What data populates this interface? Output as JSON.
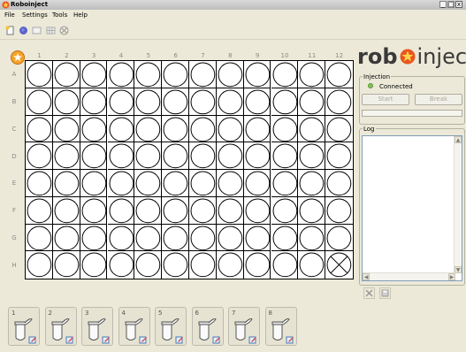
{
  "window": {
    "title": "Roboinject",
    "minimize": "_",
    "maximize": "□",
    "close": "x"
  },
  "menu": {
    "items": [
      "File",
      "Settings",
      "Tools",
      "Help"
    ]
  },
  "toolbar": {
    "icons": [
      "new-file-icon",
      "globe-icon",
      "window-icon",
      "grid-icon",
      "cancel-icon"
    ]
  },
  "plate": {
    "columns": [
      "1",
      "2",
      "3",
      "4",
      "5",
      "6",
      "7",
      "8",
      "9",
      "10",
      "11",
      "12"
    ],
    "rows": [
      "A",
      "B",
      "C",
      "D",
      "E",
      "F",
      "G",
      "H"
    ],
    "marked_well": "H12"
  },
  "logo": {
    "bold": "rob",
    "rest": "inject"
  },
  "injection": {
    "group_label": "Injection",
    "status": "Connected",
    "status_color": "#7ec850",
    "start_label": "Start",
    "break_label": "Break",
    "progress": 0
  },
  "log": {
    "group_label": "Log",
    "clear_icon": "clear-log-icon",
    "save_icon": "save-log-icon"
  },
  "slots": [
    {
      "number": "1"
    },
    {
      "number": "2"
    },
    {
      "number": "3"
    },
    {
      "number": "4"
    },
    {
      "number": "5"
    },
    {
      "number": "6"
    },
    {
      "number": "7"
    },
    {
      "number": "8"
    }
  ],
  "colors": {
    "accent": "#f6a32a",
    "background": "#ece9d8"
  }
}
